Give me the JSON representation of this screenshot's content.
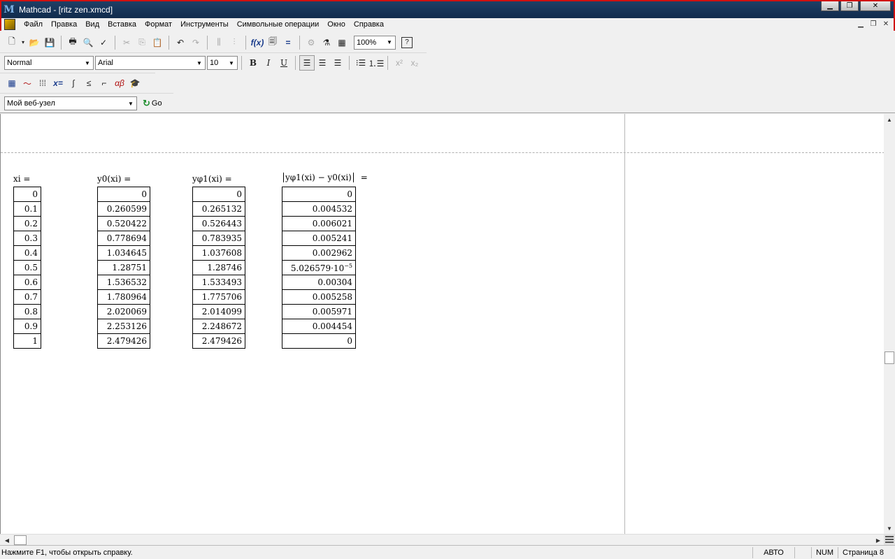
{
  "window": {
    "title": "Mathcad - [ritz  zen.xmcd]",
    "app_logo_text": "M"
  },
  "menu": [
    "Файл",
    "Правка",
    "Вид",
    "Вставка",
    "Формат",
    "Инструменты",
    "Символьные операции",
    "Окно",
    "Справка"
  ],
  "toolbar": {
    "zoom": "100%",
    "style": "Normal",
    "font": "Arial",
    "font_size": "10",
    "bold": "B",
    "italic": "I",
    "underline": "U",
    "web_address": "Мой веб-узел",
    "go_label": "Go"
  },
  "worksheet": {
    "columns": [
      {
        "header": "xi =",
        "values": [
          "0",
          "0.1",
          "0.2",
          "0.3",
          "0.4",
          "0.5",
          "0.6",
          "0.7",
          "0.8",
          "0.9",
          "1"
        ]
      },
      {
        "header": "y0(xi)  =",
        "values": [
          "0",
          "0.260599",
          "0.520422",
          "0.778694",
          "1.034645",
          "1.28751",
          "1.536532",
          "1.780964",
          "2.020069",
          "2.253126",
          "2.479426"
        ]
      },
      {
        "header": "yφ1(xi)  =",
        "values": [
          "0",
          "0.265132",
          "0.526443",
          "0.783935",
          "1.037608",
          "1.28746",
          "1.533493",
          "1.775706",
          "2.014099",
          "2.248672",
          "2.479426"
        ]
      },
      {
        "header": "yφ1(xi) − y0(xi)",
        "header_suffix": "=",
        "values": [
          "0",
          "0.004532",
          "0.006021",
          "0.005241",
          "0.002962",
          "5.026579·10",
          "0.00304",
          "0.005258",
          "0.005971",
          "0.004454",
          "0"
        ],
        "exponent_row": 5,
        "exponent": "−5"
      }
    ]
  },
  "status": {
    "message": "Нажмите F1, чтобы открыть справку.",
    "mode": "АВТО",
    "num": "NUM",
    "page": "Страница 8"
  }
}
